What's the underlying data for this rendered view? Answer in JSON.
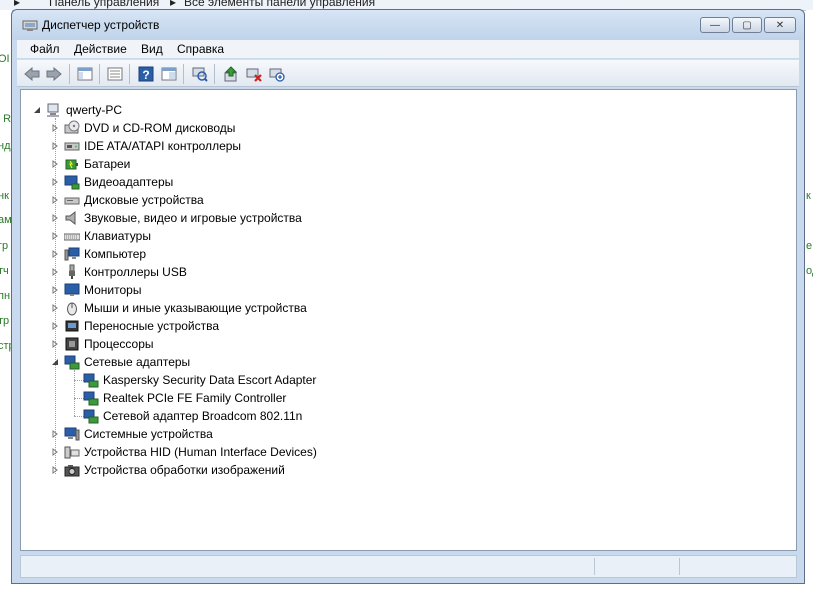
{
  "background": {
    "breadcrumb": [
      "Панель управления",
      "Все элементы панели управления"
    ],
    "left_fragments": [
      "ОІ",
      "n R",
      "нд",
      "",
      "нк",
      "ам",
      "гр",
      "тч",
      "пн",
      "тр",
      "стр"
    ],
    "right_fragments": [
      "",
      "",
      "",
      "",
      "к",
      "",
      "",
      "е",
      "од",
      "",
      ""
    ]
  },
  "window": {
    "title": "Диспетчер устройств",
    "controls": {
      "minimize": "—",
      "maximize": "▢",
      "close": "✕"
    }
  },
  "menu": [
    "Файл",
    "Действие",
    "Вид",
    "Справка"
  ],
  "toolbar": {
    "icons": [
      "back-icon",
      "forward-icon",
      "show-hide-tree-icon",
      "properties-icon",
      "help-icon",
      "show-hidden-icon",
      "scan-hardware-icon",
      "update-driver-icon",
      "uninstall-icon",
      "disable-icon"
    ]
  },
  "tree": {
    "root": "qwerty-PC",
    "categories": [
      {
        "label": "DVD и CD-ROM дисководы",
        "icon": "dvd-drive-icon",
        "expanded": false
      },
      {
        "label": "IDE ATA/ATAPI контроллеры",
        "icon": "ide-controller-icon",
        "expanded": false
      },
      {
        "label": "Батареи",
        "icon": "battery-icon",
        "expanded": false
      },
      {
        "label": "Видеоадаптеры",
        "icon": "display-adapter-icon",
        "expanded": false
      },
      {
        "label": "Дисковые устройства",
        "icon": "disk-drive-icon",
        "expanded": false
      },
      {
        "label": "Звуковые, видео и игровые устройства",
        "icon": "speaker-icon",
        "expanded": false
      },
      {
        "label": "Клавиатуры",
        "icon": "keyboard-icon",
        "expanded": false
      },
      {
        "label": "Компьютер",
        "icon": "computer-icon",
        "expanded": false
      },
      {
        "label": "Контроллеры USB",
        "icon": "usb-icon",
        "expanded": false
      },
      {
        "label": "Мониторы",
        "icon": "monitor-icon",
        "expanded": false
      },
      {
        "label": "Мыши и иные указывающие устройства",
        "icon": "mouse-icon",
        "expanded": false
      },
      {
        "label": "Переносные устройства",
        "icon": "portable-device-icon",
        "expanded": false
      },
      {
        "label": "Процессоры",
        "icon": "processor-icon",
        "expanded": false
      },
      {
        "label": "Сетевые адаптеры",
        "icon": "network-adapter-icon",
        "expanded": true,
        "children": [
          "Kaspersky Security Data Escort Adapter",
          "Realtek PCIe FE Family Controller",
          "Сетевой адаптер Broadcom 802.11n"
        ]
      },
      {
        "label": "Системные устройства",
        "icon": "system-device-icon",
        "expanded": false
      },
      {
        "label": "Устройства HID (Human Interface Devices)",
        "icon": "hid-icon",
        "expanded": false
      },
      {
        "label": "Устройства обработки изображений",
        "icon": "camera-icon",
        "expanded": false
      }
    ]
  },
  "colors": {
    "accent": "#1f5fa8",
    "frame": "#c9daee",
    "background_text": "#2a7a2a"
  }
}
